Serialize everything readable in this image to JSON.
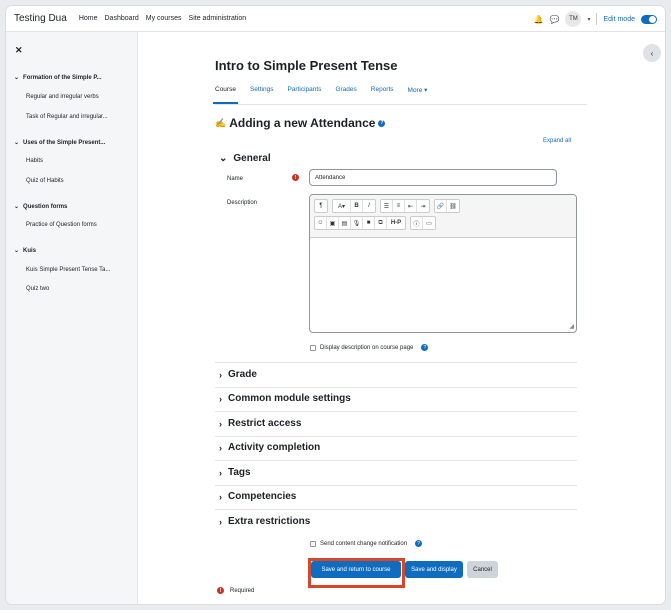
{
  "navbar": {
    "brand": "Testing Dua",
    "links": [
      "Home",
      "Dashboard",
      "My courses",
      "Site administration"
    ],
    "avatar_initials": "TM",
    "edit_mode_label": "Edit mode"
  },
  "sidebar": {
    "sections": [
      {
        "title": "Formation of the Simple P...",
        "items": [
          "Regular and irregular verbs",
          "Task of Regular and irregular..."
        ]
      },
      {
        "title": "Uses of the Simple Present...",
        "items": [
          "Habits",
          "Quiz of Habits"
        ]
      },
      {
        "title": "Question forms",
        "items": [
          "Practice of Question forms"
        ]
      },
      {
        "title": "Kuis",
        "items": [
          "Kuis Simple Present Tense Ta...",
          "Quiz two"
        ]
      }
    ]
  },
  "page": {
    "title": "Intro to Simple Present Tense",
    "tabs": [
      "Course",
      "Settings",
      "Participants",
      "Grades",
      "Reports",
      "More ▾"
    ],
    "heading": "Adding a new Attendance",
    "expand_all": "Expand all"
  },
  "form": {
    "general_title": "General",
    "name_label": "Name",
    "name_value": "Attendance",
    "description_label": "Description",
    "display_description_label": "Display description on course page",
    "sections": [
      "Grade",
      "Common module settings",
      "Restrict access",
      "Activity completion",
      "Tags",
      "Competencies",
      "Extra restrictions"
    ],
    "send_notification_label": "Send content change notification",
    "buttons": {
      "save_return": "Save and return to course",
      "save_display": "Save and display",
      "cancel": "Cancel"
    },
    "required_label": "Required"
  },
  "editor_toolbar": {
    "row1": [
      "paragraph-icon",
      "font-style-icon",
      "bold-icon",
      "italic-icon",
      "unordered-list-icon",
      "ordered-list-icon",
      "outdent-icon",
      "indent-icon",
      "link-icon",
      "unlink-icon"
    ],
    "row2": [
      "emoji-icon",
      "image-icon",
      "media-icon",
      "record-audio-icon",
      "record-video-icon",
      "manage-files-icon",
      "h5p-icon",
      "accessibility-icon",
      "screenreader-icon"
    ]
  },
  "colors": {
    "accent": "#0f6cbf",
    "required": "#ca3120",
    "highlight": "#d9472b"
  }
}
